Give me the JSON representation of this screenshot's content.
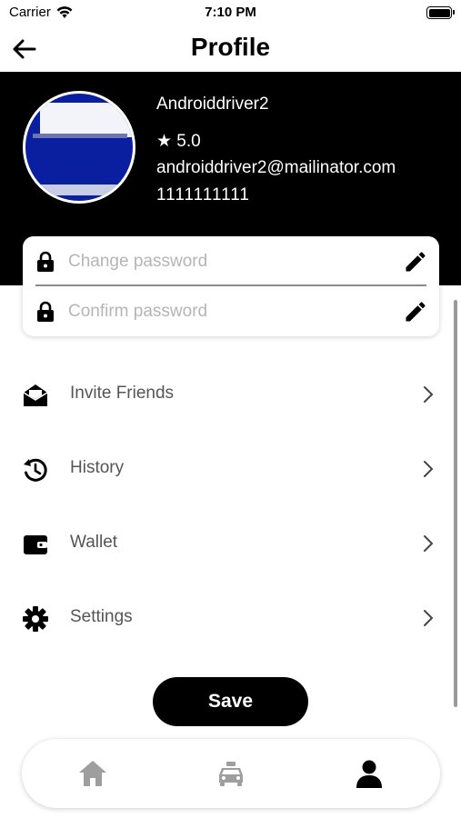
{
  "status_bar": {
    "carrier": "Carrier",
    "time": "7:10 PM"
  },
  "nav": {
    "title": "Profile",
    "back_icon": "arrow-left-icon"
  },
  "profile": {
    "name": "Androiddriver2",
    "rating": "★ 5.0",
    "email": "androiddriver2@mailinator.com",
    "phone": "1111111111"
  },
  "password": {
    "change_placeholder": "Change password",
    "confirm_placeholder": "Confirm password",
    "change_value": "",
    "confirm_value": ""
  },
  "menu": {
    "items": [
      {
        "label": "Invite Friends",
        "icon": "envelope-open-icon"
      },
      {
        "label": "History",
        "icon": "history-icon"
      },
      {
        "label": "Wallet",
        "icon": "wallet-icon"
      },
      {
        "label": "Settings",
        "icon": "gear-icon"
      }
    ]
  },
  "actions": {
    "save_label": "Save"
  },
  "tabs": [
    {
      "name": "home",
      "icon": "home-icon",
      "active": false
    },
    {
      "name": "taxi",
      "icon": "taxi-icon",
      "active": false
    },
    {
      "name": "profile",
      "icon": "person-icon",
      "active": true
    }
  ],
  "colors": {
    "header_background": "#000000",
    "accent": "#000000",
    "inactive_tab": "#9e9e9e",
    "menu_label": "#555555"
  }
}
